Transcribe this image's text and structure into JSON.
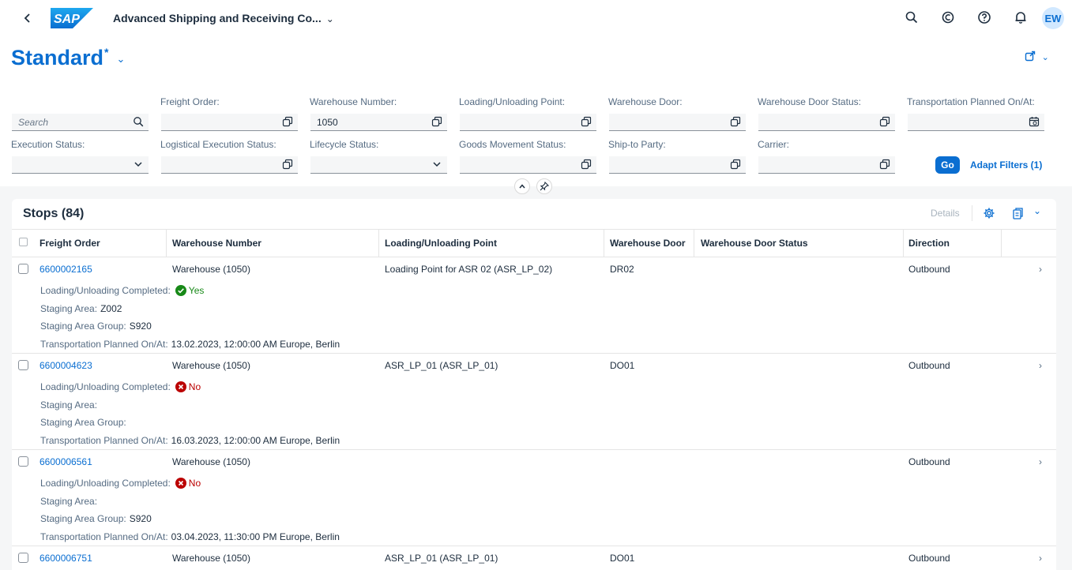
{
  "shell": {
    "logo_text": "SAP",
    "app_title": "Advanced Shipping and Receiving Co...",
    "avatar_initials": "EW"
  },
  "variant": {
    "name": "Standard",
    "dirty_marker": "*"
  },
  "filters": {
    "search_placeholder": "Search",
    "freight_order": {
      "label": "Freight Order:",
      "value": ""
    },
    "warehouse_number": {
      "label": "Warehouse Number:",
      "value": "1050"
    },
    "loading_point": {
      "label": "Loading/Unloading Point:",
      "value": ""
    },
    "warehouse_door": {
      "label": "Warehouse Door:",
      "value": ""
    },
    "warehouse_door_status": {
      "label": "Warehouse Door Status:",
      "value": ""
    },
    "transportation_planned": {
      "label": "Transportation Planned On/At:",
      "value": ""
    },
    "execution_status": {
      "label": "Execution Status:",
      "value": ""
    },
    "logistical_execution_status": {
      "label": "Logistical Execution Status:",
      "value": ""
    },
    "lifecycle_status": {
      "label": "Lifecycle Status:",
      "value": ""
    },
    "goods_movement_status": {
      "label": "Goods Movement Status:",
      "value": ""
    },
    "ship_to_party": {
      "label": "Ship-to Party:",
      "value": ""
    },
    "carrier": {
      "label": "Carrier:",
      "value": ""
    },
    "go_label": "Go",
    "adapt_label": "Adapt Filters (1)"
  },
  "table": {
    "title": "Stops (84)",
    "details_label": "Details",
    "columns": [
      "Freight Order",
      "Warehouse Number",
      "Loading/Unloading Point",
      "Warehouse Door",
      "Warehouse Door Status",
      "Direction"
    ],
    "attr_labels": {
      "completed": "Loading/Unloading Completed:",
      "staging_area": "Staging Area:",
      "staging_group": "Staging Area Group:",
      "planned": "Transportation Planned On/At:"
    },
    "rows": [
      {
        "freight_order": "6600002165",
        "warehouse_number": "Warehouse (1050)",
        "loading_point": "Loading Point for ASR 02 (ASR_LP_02)",
        "warehouse_door": "DR02",
        "door_status": "",
        "direction": "Outbound",
        "completed": "Yes",
        "staging_area": "Z002",
        "staging_group": "S920",
        "planned": "13.02.2023, 12:00:00 AM Europe, Berlin"
      },
      {
        "freight_order": "6600004623",
        "warehouse_number": "Warehouse (1050)",
        "loading_point": "ASR_LP_01 (ASR_LP_01)",
        "warehouse_door": "DO01",
        "door_status": "",
        "direction": "Outbound",
        "completed": "No",
        "staging_area": "",
        "staging_group": "",
        "planned": "16.03.2023, 12:00:00 AM Europe, Berlin"
      },
      {
        "freight_order": "6600006561",
        "warehouse_number": "Warehouse (1050)",
        "loading_point": "",
        "warehouse_door": "",
        "door_status": "",
        "direction": "Outbound",
        "completed": "No",
        "staging_area": "",
        "staging_group": "S920",
        "planned": "03.04.2023, 11:30:00 PM Europe, Berlin"
      },
      {
        "freight_order": "6600006751",
        "warehouse_number": "Warehouse (1050)",
        "loading_point": "ASR_LP_01 (ASR_LP_01)",
        "warehouse_door": "DO01",
        "door_status": "",
        "direction": "Outbound"
      }
    ]
  }
}
